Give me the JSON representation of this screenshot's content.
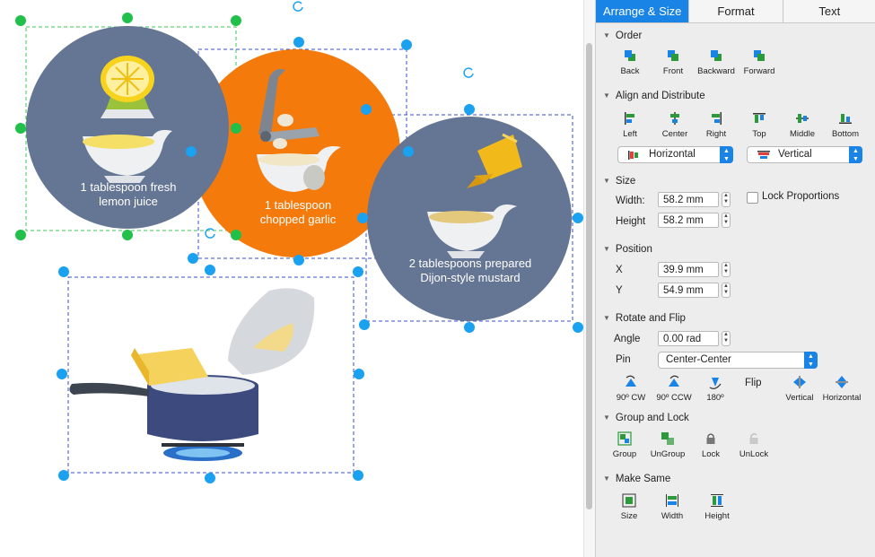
{
  "tabs": [
    {
      "label": "Arrange & Size",
      "active": true
    },
    {
      "label": "Format",
      "active": false
    },
    {
      "label": "Text",
      "active": false
    }
  ],
  "sections": {
    "order": {
      "title": "Order",
      "items": [
        "Back",
        "Front",
        "Backward",
        "Forward"
      ]
    },
    "align": {
      "title": "Align and Distribute",
      "items": [
        "Left",
        "Center",
        "Right",
        "Top",
        "Middle",
        "Bottom"
      ],
      "horizontal_select": "Horizontal",
      "vertical_select": "Vertical"
    },
    "size": {
      "title": "Size",
      "width_label": "Width:",
      "width_value": "58.2 mm",
      "height_label": "Height",
      "height_value": "58.2 mm",
      "lock_label": "Lock Proportions"
    },
    "position": {
      "title": "Position",
      "x_label": "X",
      "x_value": "39.9 mm",
      "y_label": "Y",
      "y_value": "54.9 mm"
    },
    "rotate": {
      "title": "Rotate and Flip",
      "angle_label": "Angle",
      "angle_value": "0.00 rad",
      "pin_label": "Pin",
      "pin_value": "Center-Center",
      "flip_label": "Flip",
      "items": [
        "90º CW",
        "90º CCW",
        "180º",
        "Vertical",
        "Horizontal"
      ]
    },
    "group": {
      "title": "Group and Lock",
      "items": [
        "Group",
        "UnGroup",
        "Lock",
        "UnLock"
      ]
    },
    "make_same": {
      "title": "Make Same",
      "items": [
        "Size",
        "Width",
        "Height"
      ]
    }
  },
  "canvas": {
    "lemon_label_1": "1 tablespoon fresh",
    "lemon_label_2": "lemon juice",
    "garlic_label_1": "1 tablespoon",
    "garlic_label_2": "chopped garlic",
    "mustard_label_1": "2 tablespoons prepared",
    "mustard_label_2": "Dijon-style mustard"
  },
  "colors": {
    "accent": "#1a84e6",
    "circle_slate": "#657594",
    "circle_orange": "#f57a0c",
    "handle_blue": "#1aa1f0",
    "handle_green": "#20c04a"
  },
  "icons": {
    "order": [
      "back-icon",
      "front-icon",
      "backward-icon",
      "forward-icon"
    ],
    "align": [
      "align-left-icon",
      "align-center-icon",
      "align-right-icon",
      "align-top-icon",
      "align-middle-icon",
      "align-bottom-icon"
    ],
    "rotate": [
      "rotate-cw-icon",
      "rotate-ccw-icon",
      "rotate-180-icon",
      "flip-vertical-icon",
      "flip-horizontal-icon"
    ],
    "group": [
      "group-icon",
      "ungroup-icon",
      "lock-icon",
      "unlock-icon"
    ],
    "make_same": [
      "same-size-icon",
      "same-width-icon",
      "same-height-icon"
    ]
  }
}
